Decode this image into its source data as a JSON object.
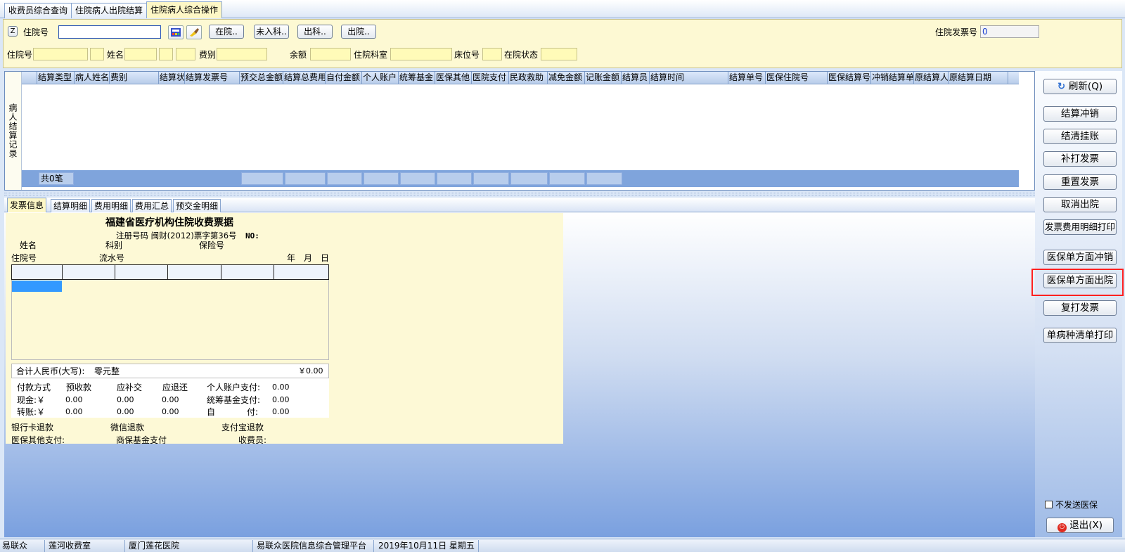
{
  "tabs": [
    {
      "label": "收费员综合查询"
    },
    {
      "label": "住院病人出院结算"
    },
    {
      "label": "住院病人综合操作"
    }
  ],
  "query": {
    "z_label": "Z",
    "admission_label": "住院号",
    "admission_value": "",
    "btn_in": "在院..",
    "btn_not_in_dept": "未入科..",
    "btn_out_dept": "出科..",
    "btn_out": "出院..",
    "invoice_no_label": "住院发票号",
    "invoice_no_value": "0"
  },
  "info": {
    "admission_label": "住院号",
    "name_label": "姓名",
    "fee_type_label": "费别",
    "balance_label": "余额",
    "dept_label": "住院科室",
    "bed_label": "床位号",
    "status_label": "在院状态"
  },
  "grid": {
    "side_label": "病人结算记录",
    "columns": [
      "结算类型",
      "病人姓名",
      "费别",
      "结算状",
      "结算发票号",
      "预交总金额",
      "结算总费用",
      "自付金额",
      "个人账户",
      "统筹基金",
      "医保其他",
      "医院支付",
      "民政救助",
      "减免金额",
      "记账金额",
      "结算员",
      "结算时间",
      "结算单号",
      "医保住院号",
      "医保结算号",
      "冲销结算单",
      "原结算人",
      "原结算日期"
    ],
    "footer_count": "共0笔"
  },
  "lower_tabs": [
    {
      "label": "发票信息"
    },
    {
      "label": "结算明细"
    },
    {
      "label": "费用明细"
    },
    {
      "label": "费用汇总"
    },
    {
      "label": "预交金明细"
    }
  ],
  "invoice": {
    "title": "福建省医疗机构住院收费票据",
    "reg_line": "注册号码 闽财(2012)票字第36号",
    "no_label": "NO:",
    "name_label": "姓名",
    "dept_label": "科别",
    "insurance_label": "保险号",
    "admission_label": "住院号",
    "serial_label": "流水号",
    "year_label": "年",
    "month_label": "月",
    "day_label": "日",
    "total_label": "合计人民币(大写):",
    "total_words": "零元整",
    "total_amount": "￥0.00",
    "pay_method_label": "付款方式",
    "prepaid_label": "预收款",
    "supplement_label": "应补交",
    "refund_label": "应退还",
    "personal_account_label": "个人账户支付:",
    "cash_label": "现金:￥",
    "pooled_fund_label": "统筹基金支付:",
    "transfer_label": "转账:￥",
    "self_label": "自",
    "pay_label": "付:",
    "zero": "0.00",
    "bank_refund_label": "银行卡退款",
    "wechat_refund_label": "微信退款",
    "alipay_refund_label": "支付宝退款",
    "insurance_other_label": "医保其他支付:",
    "commercial_fund_label": "商保基金支付",
    "cashier_label": "收费员:"
  },
  "side_buttons": {
    "refresh": "刷新(Q)",
    "settle_reverse": "结算冲销",
    "clear_account": "结清挂账",
    "reprint_invoice": "补打发票",
    "reset_invoice": "重置发票",
    "cancel_discharge": "取消出院",
    "invoice_detail_print": "发票费用明细打印",
    "insurance_unilateral_reverse": "医保单方面冲销",
    "insurance_unilateral_discharge": "医保单方面出院",
    "reprint": "复打发票",
    "single_disease_print": "单病种清单打印",
    "no_send_insurance": "不发送医保",
    "exit": "退出(X)"
  },
  "status_bar": {
    "company": "易联众",
    "room": "莲河收费室",
    "hospital": "厦门莲花医院",
    "platform": "易联众医院信息综合管理平台",
    "date": "2019年10月11日 星期五"
  },
  "colors": {
    "accent_red": "#ff2020",
    "panel_yellow": "#fdf9d3",
    "grid_header_blue": "#b9cdea"
  }
}
